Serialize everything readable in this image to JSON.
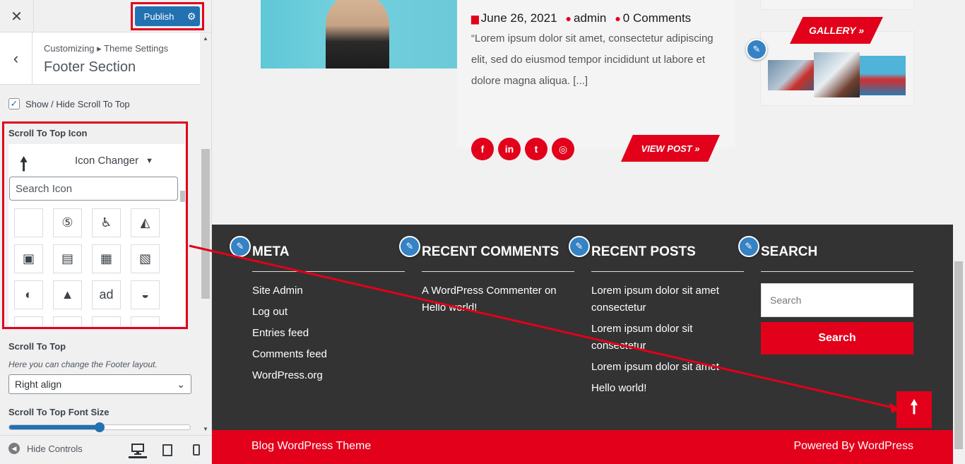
{
  "customizer": {
    "close_icon": "close-icon",
    "publish_label": "Publish",
    "breadcrumb": "Customizing ▸ Theme Settings",
    "section_title": "Footer Section",
    "show_hide_label": "Show / Hide Scroll To Top",
    "scroll_icon_title": "Scroll To Top Icon",
    "icon_changer_label": "Icon Changer",
    "search_icon_placeholder": "Search Icon",
    "icon_grid": [
      "",
      "⑤",
      "♿",
      "◭",
      "▣",
      "▤",
      "▦",
      "▧",
      "◐",
      "▲",
      "ad",
      "◒"
    ],
    "scroll_top_label": "Scroll To Top",
    "scroll_top_desc": "Here you can change the Footer layout.",
    "align_value": "Right align",
    "font_size_label": "Scroll To Top Font Size",
    "font_size_level": 0.5,
    "hide_controls_label": "Hide Controls"
  },
  "post": {
    "date": "June 26, 2021",
    "author": "admin",
    "comments": "0 Comments",
    "excerpt": "“Lorem ipsum dolor sit amet, consectetur adipiscing elit, sed do eiusmod tempor incididunt ut labore et dolore magna aliqua. [...]",
    "socials": [
      "f",
      "in",
      "t",
      "◎"
    ],
    "view_post_label": "VIEW POST »"
  },
  "sidebar": {
    "gallery_label": "GALLERY »"
  },
  "footer": {
    "meta_title": "META",
    "meta_links": [
      "Site Admin",
      "Log out",
      "Entries feed",
      "Comments feed",
      "WordPress.org"
    ],
    "comments_title": "RECENT COMMENTS",
    "comment_text": "A WordPress Commenter on Hello world!",
    "posts_title": "RECENT POSTS",
    "recent_posts": [
      "Lorem ipsum dolor sit amet consectetur",
      "Lorem ipsum dolor sit consectetur",
      "Lorem ipsum dolor sit amet",
      "Hello world!"
    ],
    "search_title": "SEARCH",
    "search_placeholder": "Search",
    "search_button": "Search",
    "bottom_left": "Blog WordPress Theme",
    "bottom_right": "Powered By WordPress"
  },
  "colors": {
    "accent": "#e2001a",
    "wp_blue": "#2271b1",
    "footer_bg": "#333333"
  }
}
